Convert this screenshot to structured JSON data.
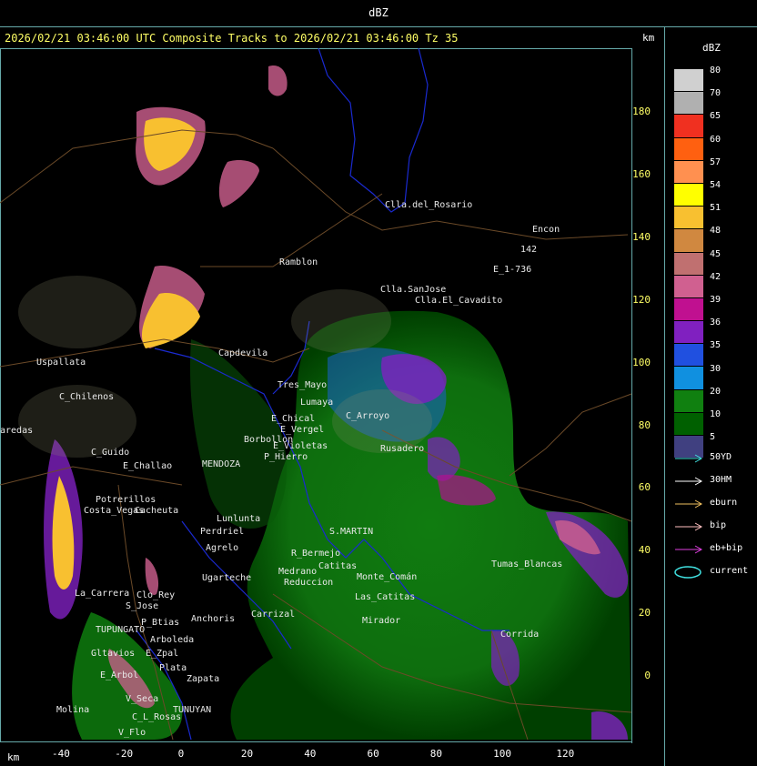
{
  "window_title": "dBZ",
  "header": "2026/02/21 03:46:00 UTC Composite Tracks to 2026/02/21 03:46:00 Tz 35",
  "km_label_top": "km",
  "km_label_bottom": "km",
  "legend": {
    "title": "dBZ",
    "scale": [
      {
        "label": "80",
        "color": "#d0d0d0"
      },
      {
        "label": "70",
        "color": "#b0b0b0"
      },
      {
        "label": "65",
        "color": "#f03020"
      },
      {
        "label": "60",
        "color": "#ff6010"
      },
      {
        "label": "57",
        "color": "#ff9050"
      },
      {
        "label": "54",
        "color": "#ffff00"
      },
      {
        "label": "51",
        "color": "#f8c030"
      },
      {
        "label": "48",
        "color": "#d08840"
      },
      {
        "label": "45",
        "color": "#c07070"
      },
      {
        "label": "42",
        "color": "#d06090"
      },
      {
        "label": "39",
        "color": "#c01090"
      },
      {
        "label": "36",
        "color": "#8020c0"
      },
      {
        "label": "35",
        "color": "#2050e0"
      },
      {
        "label": "30",
        "color": "#1090e0"
      },
      {
        "label": "20",
        "color": "#108010"
      },
      {
        "label": "10",
        "color": "#006000"
      },
      {
        "label": "5",
        "color": "#404080"
      }
    ],
    "tracks": [
      {
        "label": "50YD",
        "color": "#40e0e0"
      },
      {
        "label": "30HM",
        "color": "#ffffff"
      },
      {
        "label": "eburn",
        "color": "#f0c060"
      },
      {
        "label": "bip",
        "color": "#ffc0c0"
      },
      {
        "label": "eb+bip",
        "color": "#e040e0"
      },
      {
        "label": "current",
        "color": "#40e0e0"
      }
    ]
  },
  "y_ticks": [
    "180",
    "160",
    "140",
    "120",
    "100",
    "80",
    "60",
    "40",
    "20",
    "0"
  ],
  "x_ticks": [
    "-40",
    "-20",
    "0",
    "20",
    "40",
    "60",
    "80",
    "100",
    "120"
  ],
  "places": [
    {
      "name": "Clla.del_Rosario"
    },
    {
      "name": "Encon"
    },
    {
      "name": "142"
    },
    {
      "name": "E_1-736"
    },
    {
      "name": "Ramblon"
    },
    {
      "name": "Clla.SanJose"
    },
    {
      "name": "Clla.El_Cavadito"
    },
    {
      "name": "Uspallata"
    },
    {
      "name": "Potrerillos"
    },
    {
      "name": "C_Chilenos"
    },
    {
      "name": "aredas"
    },
    {
      "name": "C_Guido"
    },
    {
      "name": "E_Challao"
    },
    {
      "name": "Capdevila"
    },
    {
      "name": "Tres_Mayo"
    },
    {
      "name": "Lumaya"
    },
    {
      "name": "E_Chical"
    },
    {
      "name": "E_Vergel"
    },
    {
      "name": "C_Arroyo"
    },
    {
      "name": "Borbollon"
    },
    {
      "name": "P_Hierro"
    },
    {
      "name": "E_Violetas"
    },
    {
      "name": "Rusadero"
    },
    {
      "name": "MENDOZA"
    },
    {
      "name": "Lunlunta"
    },
    {
      "name": "Perdriel"
    },
    {
      "name": "Agrelo"
    },
    {
      "name": "Ugarteche"
    },
    {
      "name": "S.MARTIN"
    },
    {
      "name": "R_Bermejo"
    },
    {
      "name": "Medrano"
    },
    {
      "name": "Reduccion"
    },
    {
      "name": "Catitas"
    },
    {
      "name": "Las_Catitas"
    },
    {
      "name": "Monte_Comán"
    },
    {
      "name": "Mirador"
    },
    {
      "name": "Tumas_Blancas"
    },
    {
      "name": "Corrida"
    },
    {
      "name": "La_Carrera"
    },
    {
      "name": "Clo_Rey"
    },
    {
      "name": "S_Jose"
    },
    {
      "name": "P_Btias"
    },
    {
      "name": "Anchoris"
    },
    {
      "name": "TUPUNGATO"
    },
    {
      "name": "Arboleda"
    },
    {
      "name": "Gltavios"
    },
    {
      "name": "E_Zpal"
    },
    {
      "name": "Plata"
    },
    {
      "name": "Zapata"
    },
    {
      "name": "E_Arbol"
    },
    {
      "name": "V_Seca"
    },
    {
      "name": "Carrizal"
    },
    {
      "name": "TUNUYAN"
    },
    {
      "name": "C_L_Rosas"
    },
    {
      "name": "Molina"
    },
    {
      "name": "V_Flo"
    },
    {
      "name": "Costa_Vegas"
    },
    {
      "name": "Cacheuta"
    }
  ]
}
